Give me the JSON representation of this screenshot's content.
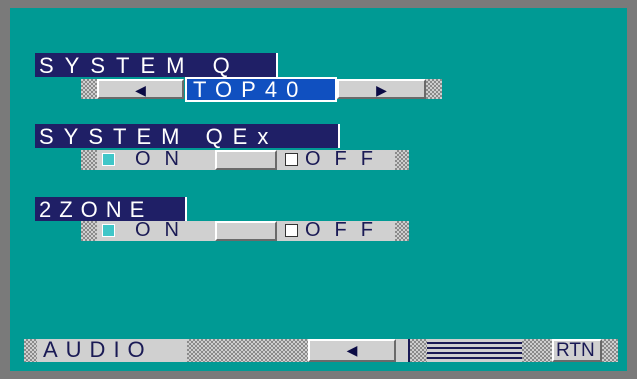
{
  "system_q": {
    "title": "SYSTEM Q",
    "prev_icon": "◀",
    "value": "TOP40",
    "next_icon": "▶"
  },
  "system_qex": {
    "title": "SYSTEM QEx",
    "on_label": "ON",
    "off_label": "OFF",
    "selected": "ON"
  },
  "two_zone": {
    "title": "2ZONE",
    "on_label": "ON",
    "off_label": "OFF",
    "selected": "ON"
  },
  "bottom_bar": {
    "source_label": "AUDIO",
    "back_icon": "◀",
    "rtn_label": "RTN"
  },
  "colors": {
    "screen_bg": "#009a94",
    "frame": "#7a7a7a",
    "title_bg": "#1f1f66",
    "selection_bg": "#1050c0",
    "button_bg": "#d0d0d0"
  }
}
